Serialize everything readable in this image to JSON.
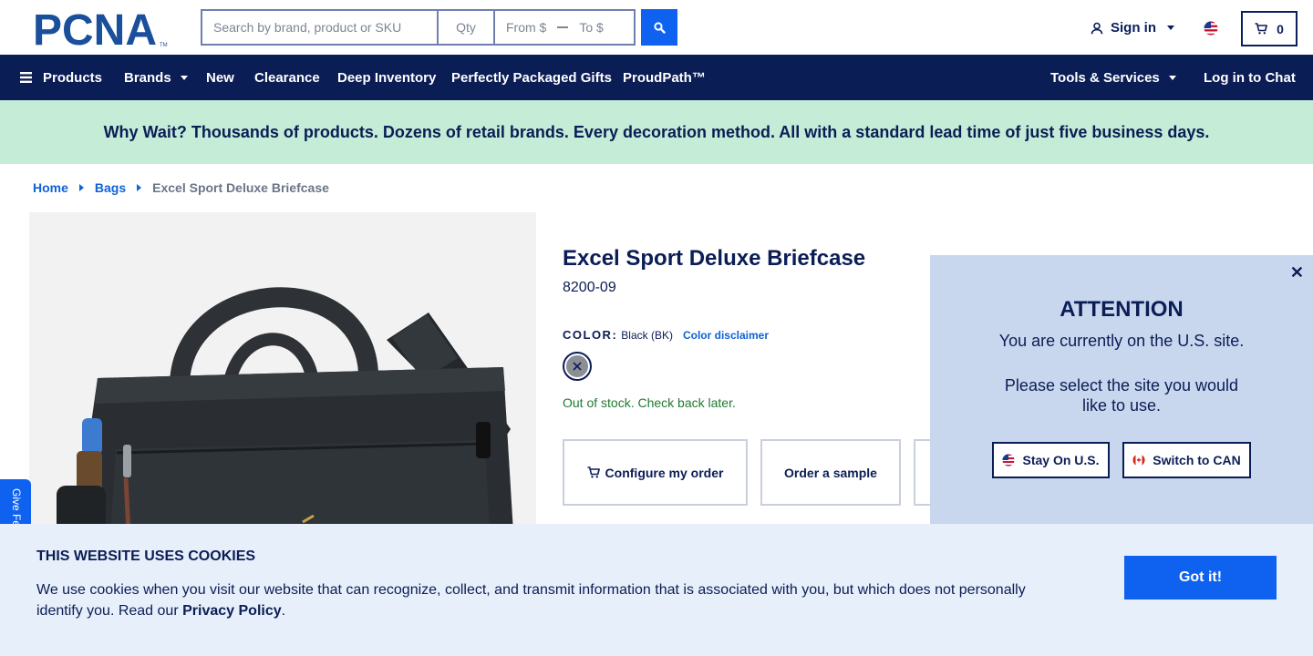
{
  "header": {
    "logo_text": "PCNA",
    "logo_mark": "TM",
    "search_placeholder": "Search by brand, product or SKU",
    "qty_placeholder": "Qty",
    "from_placeholder": "From $",
    "to_placeholder": "To $",
    "signin_label": "Sign in",
    "cart_count": "0"
  },
  "nav": {
    "products": "Products",
    "brands": "Brands",
    "new": "New",
    "clearance": "Clearance",
    "deep_inventory": "Deep Inventory",
    "gifts": "Perfectly Packaged Gifts",
    "proudpath": "ProudPath™",
    "tools": "Tools & Services",
    "chat": "Log in to Chat"
  },
  "promo": "Why Wait? Thousands of products. Dozens of retail brands. Every decoration method. All with a standard lead time of just five business days.",
  "breadcrumb": {
    "home": "Home",
    "category": "Bags",
    "current": "Excel Sport Deluxe Briefcase"
  },
  "product": {
    "title": "Excel Sport Deluxe Briefcase",
    "sku": "8200-09",
    "color_label": "COLOR:",
    "color_value": "Black (BK)",
    "color_disclaimer": "Color disclaimer",
    "stock": "Out of stock. Check back later.",
    "configure": "Configure my order",
    "sample": "Order a sample"
  },
  "feedback": "Give Feedback",
  "attention": {
    "title": "ATTENTION",
    "line1": "You are currently on the U.S. site.",
    "line2": "Please select the site you would like to use.",
    "stay": "Stay On U.S.",
    "switch": "Switch to CAN"
  },
  "cookie": {
    "title": "THIS WEBSITE USES COOKIES",
    "text": "We use cookies when you visit our website that can recognize, collect, and transmit information that is associated with you, but which does not personally identify you. Read our",
    "link": "Privacy Policy",
    "button": "Got it!"
  },
  "colors": {
    "navy": "#0b1d55",
    "blue": "#0f62f0",
    "promo_bg": "#c4ecd6",
    "popup_bg": "#c9d7ee",
    "cookie_bg": "#e7effa",
    "stock_green": "#1f7a2e"
  }
}
